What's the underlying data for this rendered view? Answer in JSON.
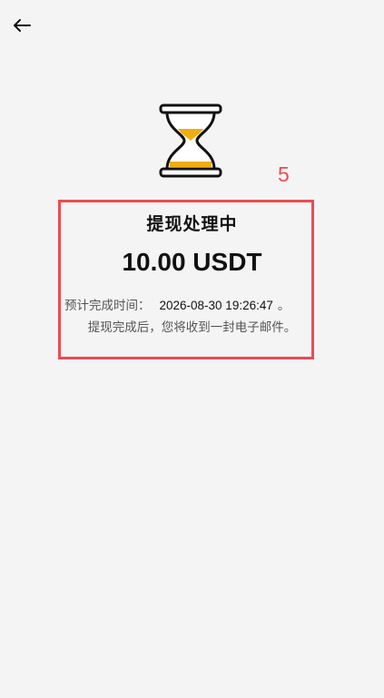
{
  "header": {
    "back_icon": "arrow-left-icon"
  },
  "status": {
    "icon": "hourglass-icon",
    "title": "提现处理中",
    "amount": "10.00 USDT",
    "eta_label": "预计完成时间：",
    "eta_time": "2026-08-30 19:26:47",
    "eta_end": "。",
    "note": "提现完成后，您将收到一封电子邮件。"
  },
  "annotation": {
    "label": "5",
    "color": "#ee4a52"
  },
  "colors": {
    "accent": "#f0ad0c",
    "background": "#f4f4f4"
  }
}
